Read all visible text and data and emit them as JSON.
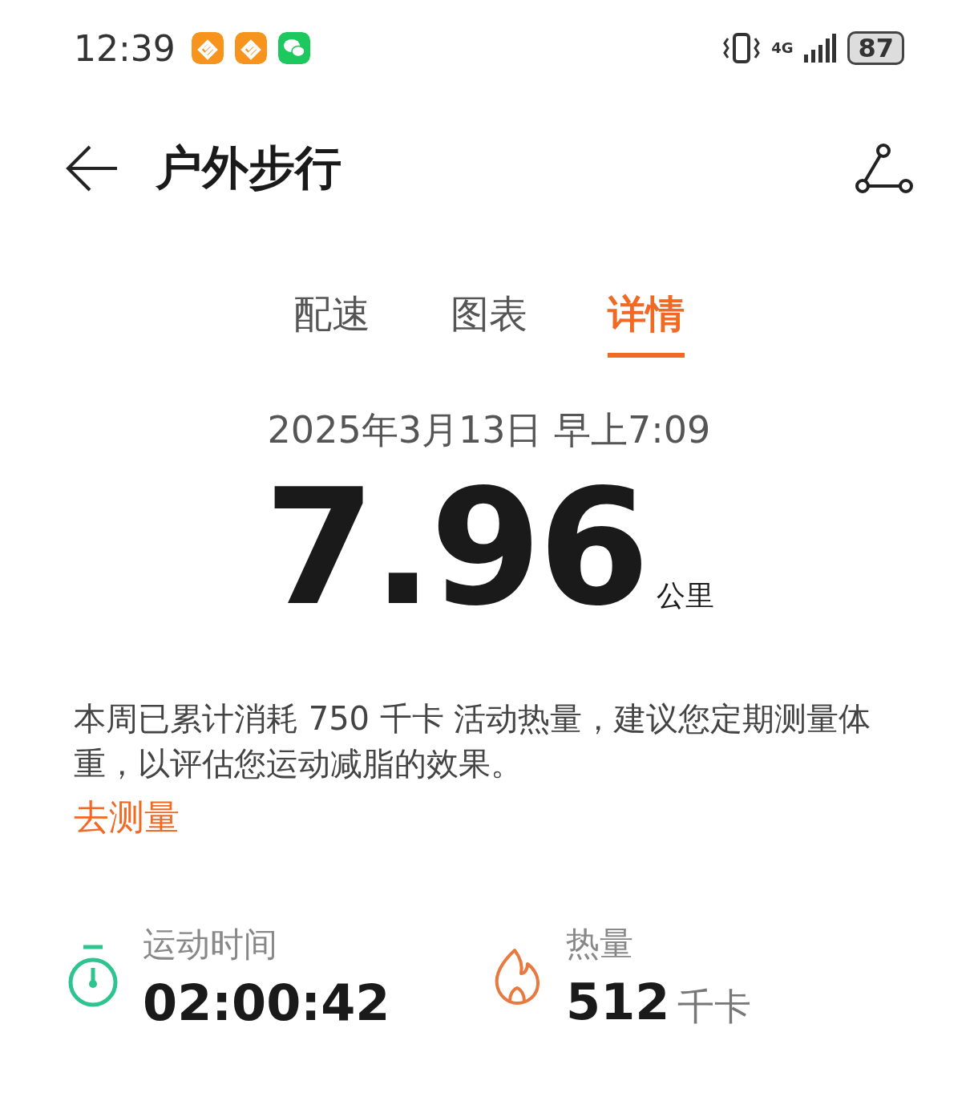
{
  "status_bar": {
    "time": "12:39",
    "network": "4G",
    "battery": "87"
  },
  "header": {
    "title": "户外步行"
  },
  "tabs": [
    {
      "label": "配速",
      "selected": false
    },
    {
      "label": "图表",
      "selected": false
    },
    {
      "label": "详情",
      "selected": true
    }
  ],
  "date": "2025年3月13日 早上7:09",
  "distance": {
    "value": "7.96",
    "unit": "公里"
  },
  "note": {
    "text": "本周已累计消耗 750 千卡 活动热量，建议您定期测量体重，以评估您运动减脂的效果。",
    "link": "去测量"
  },
  "stats": [
    {
      "kind": "duration",
      "label": "运动时间",
      "value": "02:00:42"
    },
    {
      "kind": "calories",
      "label": "热量",
      "value": "512",
      "unit": "千卡"
    }
  ]
}
